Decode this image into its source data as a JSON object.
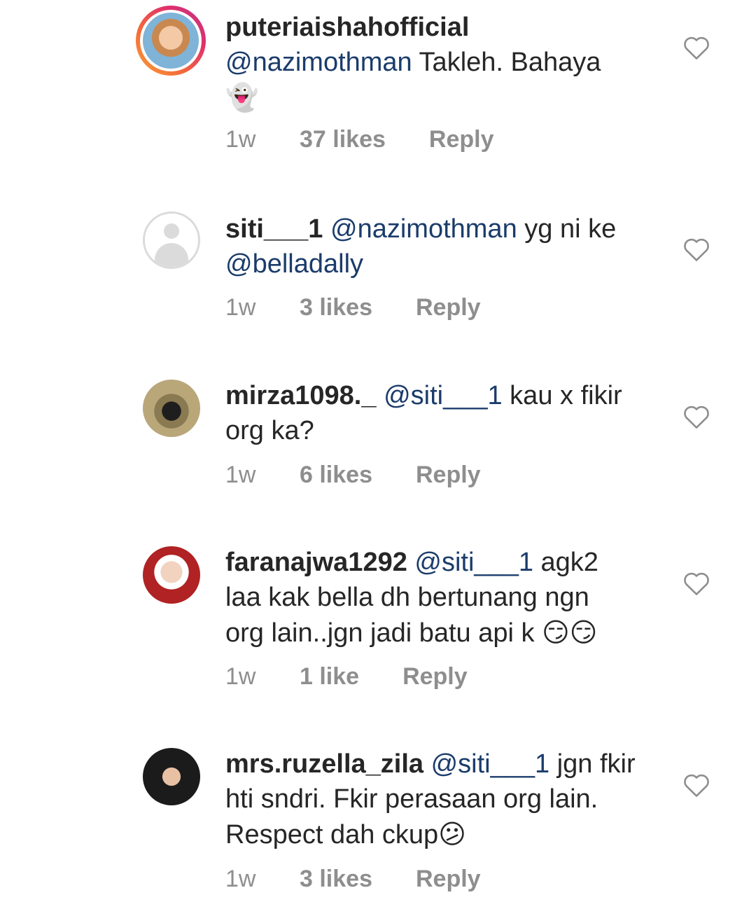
{
  "comments": [
    {
      "username": "puteriaishahofficial",
      "mention": "",
      "text_line1_mention": "@nazimothman",
      "text_line1_rest": " Takleh. Bahaya",
      "emoji": "👻",
      "time": "1w",
      "likes": "37 likes",
      "reply": "Reply"
    },
    {
      "username": "siti___1",
      "mention": "@nazimothman",
      "text_rest": " yg ni ke",
      "mention2": "@belladally",
      "time": "1w",
      "likes": "3 likes",
      "reply": "Reply"
    },
    {
      "username": "mirza1098._",
      "mention": "@siti___1",
      "text_rest": " kau x fikir",
      "line2": "org ka?",
      "time": "1w",
      "likes": "6 likes",
      "reply": "Reply"
    },
    {
      "username": "faranajwa1292",
      "mention": "@siti___1",
      "text_rest": " agk2",
      "line2": "laa kak bella dh bertunang ngn",
      "line3": "org lain..jgn jadi batu api k ",
      "emoji": "😏😏",
      "time": "1w",
      "likes": "1 like",
      "reply": "Reply"
    },
    {
      "username": "mrs.ruzella_zila",
      "mention": "@siti___1",
      "text_rest": " jgn fkir",
      "line2": "hti sndri. Fkir perasaan org lain.",
      "line3": "Respect dah ckup",
      "emoji": "😕",
      "time": "1w",
      "likes": "3 likes",
      "reply": "Reply"
    }
  ],
  "icons": {
    "heart": "heart-icon",
    "ghost": "ghost-emoji",
    "colors": {
      "text": "#262626",
      "meta": "#8e8e8e",
      "mention": "#1b3c6b",
      "heart_stroke": "#8e8e8e"
    }
  }
}
